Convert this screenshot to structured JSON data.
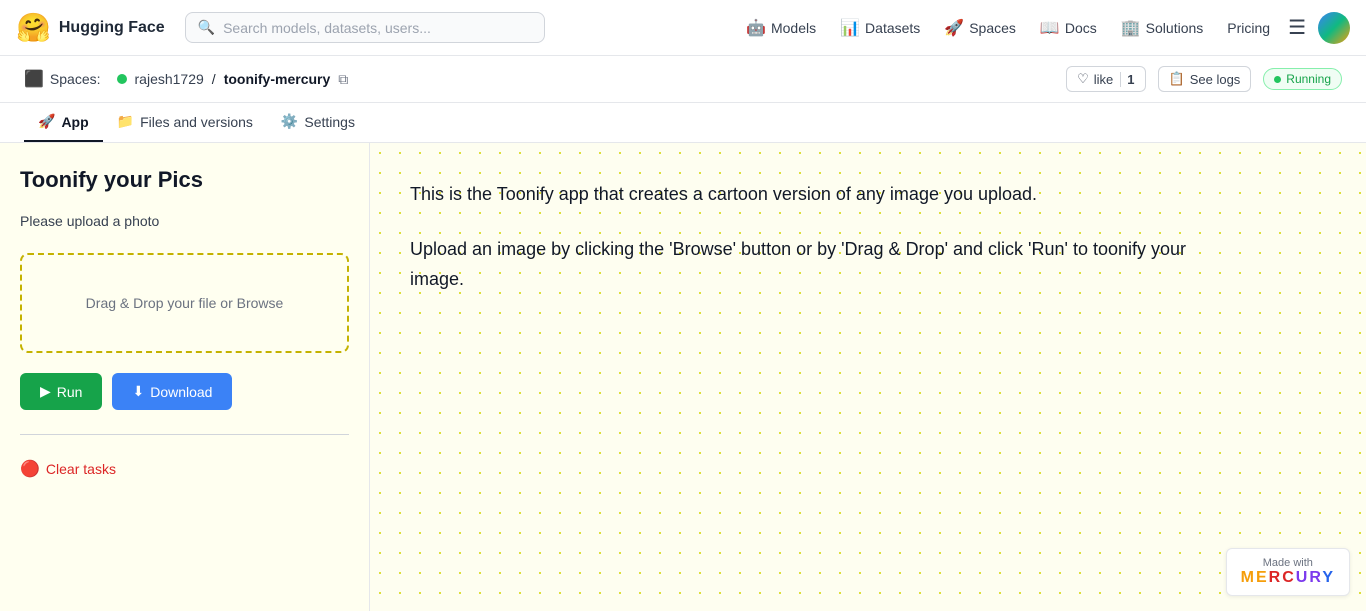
{
  "navbar": {
    "logo_emoji": "🤗",
    "logo_text": "Hugging Face",
    "search_placeholder": "Search models, datasets, users...",
    "nav_items": [
      {
        "id": "models",
        "label": "Models",
        "icon": "🤖"
      },
      {
        "id": "datasets",
        "label": "Datasets",
        "icon": "📊"
      },
      {
        "id": "spaces",
        "label": "Spaces",
        "icon": "🚀"
      },
      {
        "id": "docs",
        "label": "Docs",
        "icon": "📖"
      },
      {
        "id": "solutions",
        "label": "Solutions",
        "icon": "🏢"
      },
      {
        "id": "pricing",
        "label": "Pricing"
      }
    ]
  },
  "breadcrumb": {
    "spaces_label": "Spaces:",
    "user": "rajesh1729",
    "separator": "/",
    "repo": "toonify-mercury",
    "like_label": "like",
    "like_count": "1",
    "see_logs_label": "See logs",
    "status": "Running"
  },
  "tabs": [
    {
      "id": "app",
      "label": "App",
      "icon": "🚀",
      "active": true
    },
    {
      "id": "files",
      "label": "Files and versions",
      "icon": "📁",
      "active": false
    },
    {
      "id": "settings",
      "label": "Settings",
      "icon": "⚙️",
      "active": false
    }
  ],
  "sidebar": {
    "title": "Toonify your Pics",
    "upload_label": "Please upload a photo",
    "drop_text": "Drag & Drop your file or Browse",
    "run_btn_label": "Run",
    "download_btn_label": "Download",
    "clear_tasks_label": "Clear tasks"
  },
  "content": {
    "paragraph1": "This is the Toonify app that creates a cartoon version of any image you upload.",
    "paragraph2": "Upload an image by clicking the 'Browse' button or by 'Drag & Drop' and click 'Run' to toonify your image."
  },
  "footer": {
    "made_with": "Made with",
    "mercury_letters": [
      "M",
      "E",
      "R",
      "C",
      "U",
      "R",
      "Y"
    ]
  }
}
